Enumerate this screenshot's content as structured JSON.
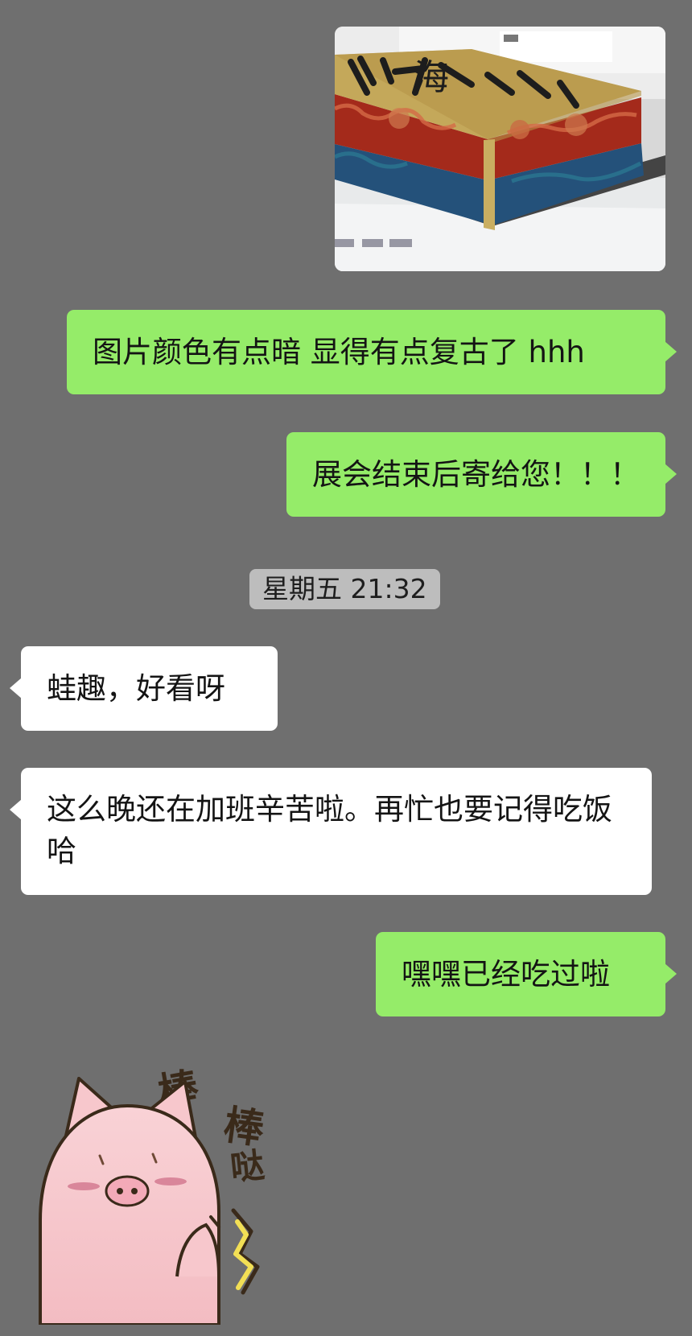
{
  "conversation": {
    "image_message": {
      "visible_text": "海"
    },
    "messages": [
      {
        "text": "图片颜色有点暗 显得有点复古了 hhh"
      },
      {
        "text": "展会结束后寄给您！！！"
      },
      {
        "text": "蛙趣，好看呀"
      },
      {
        "text": "这么晚还在加班辛苦啦。再忙也要记得吃饭哈"
      },
      {
        "text": "嘿嘿已经吃过啦"
      }
    ],
    "timestamp": "星期五 21:32",
    "sticker": {
      "caption_chars": [
        "棒",
        "棒",
        "哒"
      ]
    }
  },
  "colors": {
    "background": "#6f6f6f",
    "sent_bubble": "#95ec69",
    "received_bubble": "#ffffff",
    "timestamp_pill": "#bdbdbd",
    "pig": "#f7c7cc",
    "sticker_text": "#3a2a1a"
  },
  "icons": {
    "sticker": "pig-thumbs-up-sticker"
  }
}
